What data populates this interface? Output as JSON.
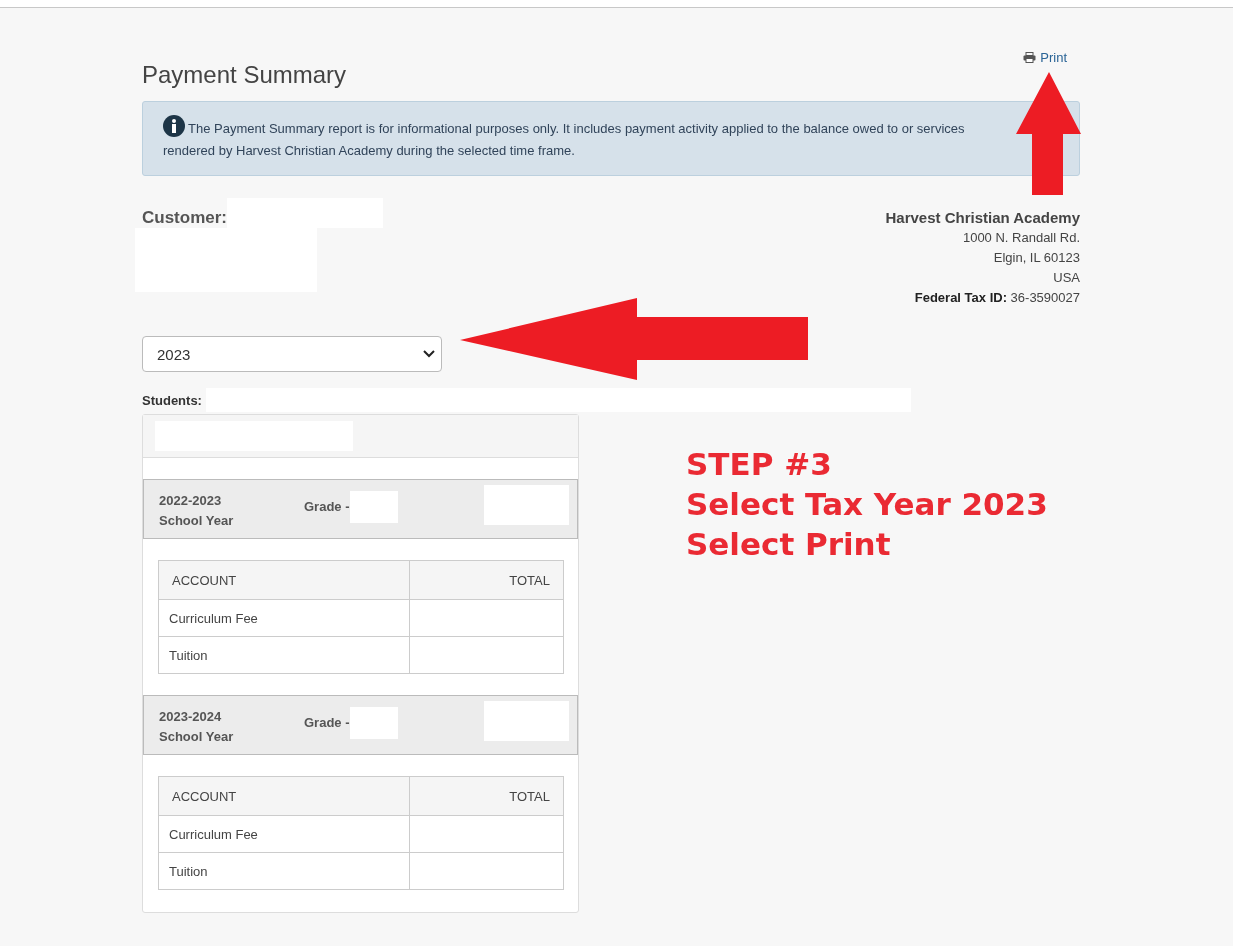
{
  "page": {
    "title": "Payment Summary",
    "print_link": "Print"
  },
  "notice": "The Payment Summary report is for informational purposes only. It includes payment activity applied to the balance owed to or services rendered by Harvest Christian Academy during the selected time frame.",
  "customer": {
    "label": "Customer:"
  },
  "academy": {
    "name": "Harvest Christian Academy",
    "address_lines": [
      "1000 N. Randall Rd.",
      "Elgin, IL 60123",
      "USA"
    ],
    "tax_id_label": "Federal Tax ID:",
    "tax_id": "36-3590027"
  },
  "year_select": {
    "value": "2023"
  },
  "students": {
    "label": "Students:"
  },
  "school_years": [
    {
      "year": "2022-2023",
      "term": "School Year",
      "grade_label": "Grade -",
      "columns": [
        "ACCOUNT",
        "TOTAL"
      ],
      "rows": [
        "Curriculum Fee",
        "Tuition"
      ]
    },
    {
      "year": "2023-2024",
      "term": "School Year",
      "grade_label": "Grade -",
      "columns": [
        "ACCOUNT",
        "TOTAL"
      ],
      "rows": [
        "Curriculum Fee",
        "Tuition"
      ]
    }
  ],
  "annotation": {
    "lines": [
      "STEP #3",
      "Select Tax Year 2023",
      "Select Print"
    ]
  }
}
